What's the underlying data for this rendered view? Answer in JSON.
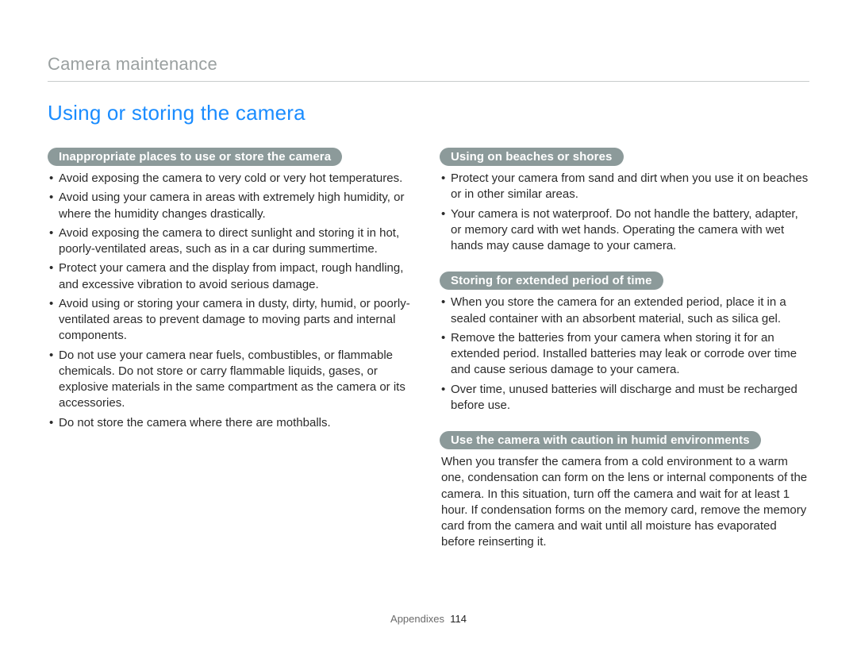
{
  "header": {
    "title": "Camera maintenance"
  },
  "main": {
    "heading": "Using or storing the camera",
    "left": {
      "section1": {
        "title": "Inappropriate places to use or store the camera",
        "items": [
          "Avoid exposing the camera to very cold or very hot temperatures.",
          "Avoid using your camera in areas with extremely high humidity, or where the humidity changes drastically.",
          "Avoid exposing the camera to direct sunlight and storing it in hot, poorly-ventilated areas, such as in a car during summertime.",
          "Protect your camera and the display from impact, rough handling, and excessive vibration to avoid serious damage.",
          "Avoid using or storing your camera in dusty, dirty, humid, or poorly-ventilated areas to prevent damage to moving parts and internal components.",
          "Do not use your camera near fuels, combustibles, or flammable chemicals. Do not store or carry flammable liquids, gases, or explosive materials in the same compartment as the camera or its accessories.",
          "Do not store the camera where there are mothballs."
        ]
      }
    },
    "right": {
      "section1": {
        "title": "Using on beaches or shores",
        "items": [
          "Protect your camera from sand and dirt when you use it on beaches or in other similar areas.",
          "Your camera is not waterproof. Do not handle the battery, adapter, or memory card with wet hands. Operating the camera with wet hands may cause damage to your camera."
        ]
      },
      "section2": {
        "title": "Storing for extended period of time",
        "items": [
          "When you store the camera for an extended period, place it in a sealed container with an absorbent material, such as silica gel.",
          "Remove the batteries from your camera when storing it for an extended period. Installed batteries may leak or corrode over time and cause serious damage to your camera.",
          "Over time, unused batteries will discharge and must be recharged before use."
        ]
      },
      "section3": {
        "title": "Use the camera with caution in humid environments",
        "paragraph": "When you transfer the camera from a cold environment to a warm one, condensation can form on the lens or internal components of the camera. In this situation, turn off the camera and wait for at least 1 hour. If condensation forms on the memory card, remove the memory card from the camera and wait until all moisture has evaporated before reinserting it."
      }
    }
  },
  "footer": {
    "label": "Appendixes",
    "page": "114"
  }
}
